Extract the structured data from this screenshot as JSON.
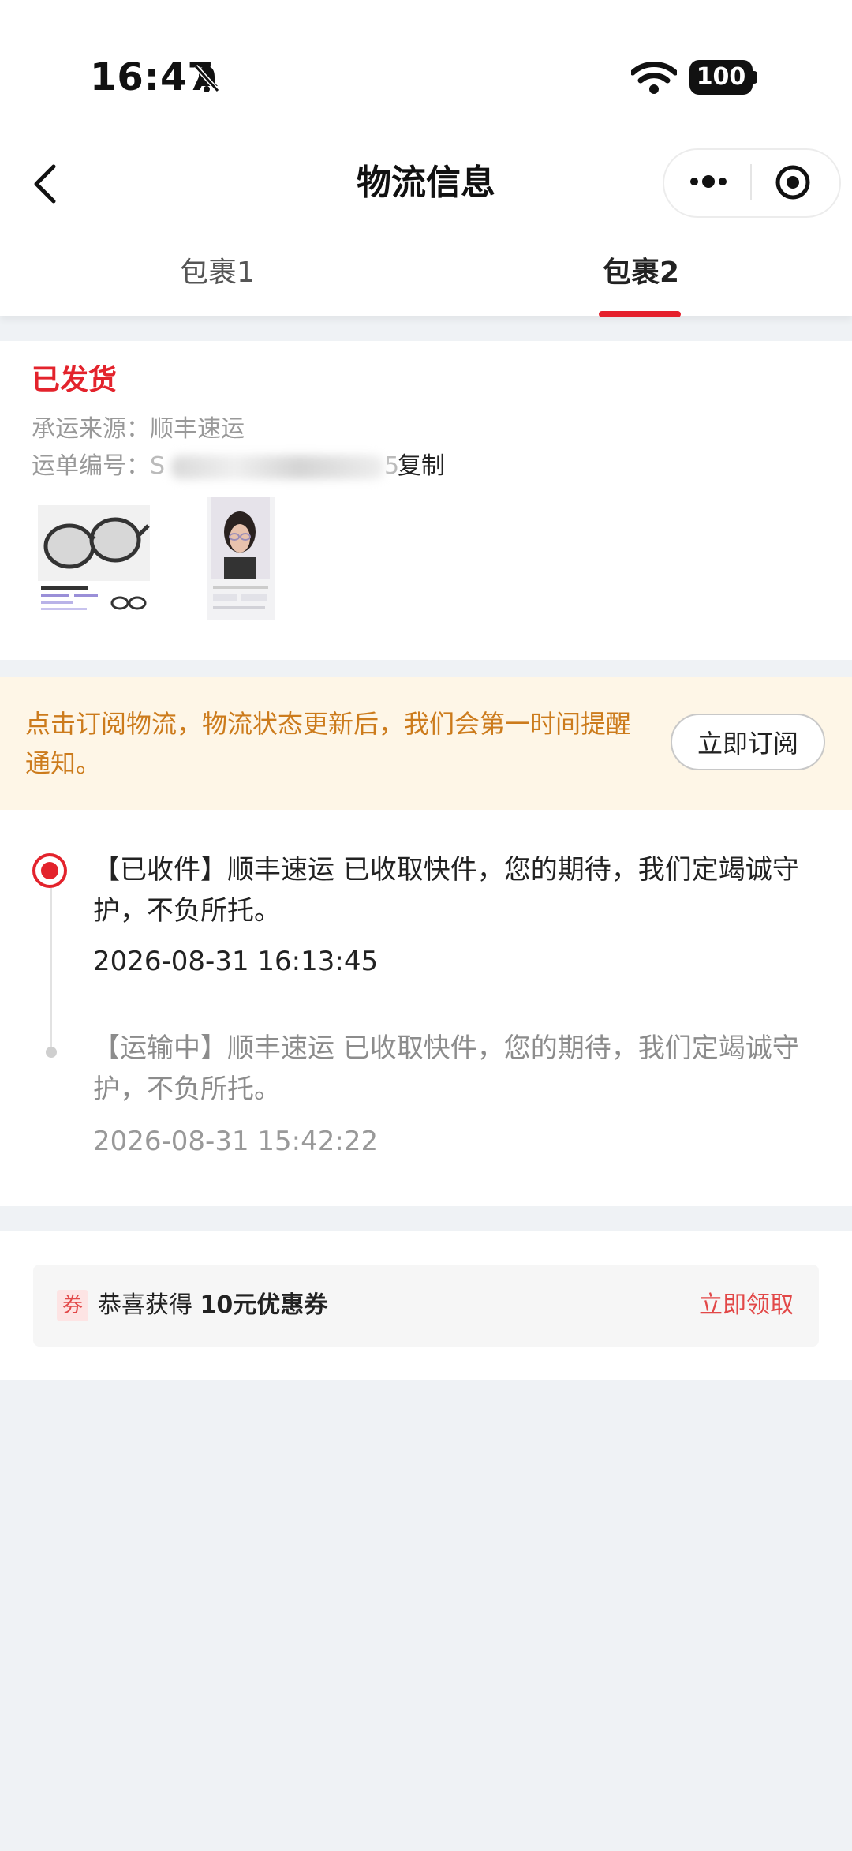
{
  "status_bar": {
    "time": "16:47",
    "battery": "100"
  },
  "nav": {
    "title": "物流信息"
  },
  "tabs": [
    {
      "label": "包裹1"
    },
    {
      "label": "包裹2"
    }
  ],
  "package": {
    "status": "已发货",
    "carrier_label": "承运来源：",
    "carrier_value": "顺丰速运",
    "waybill_label": "运单编号：",
    "waybill_visible_prefix": "S",
    "waybill_visible_suffix": "5",
    "copy_label": "复制"
  },
  "subscribe": {
    "text": "点击订阅物流，物流状态更新后，我们会第一时间提醒通知。",
    "button": "立即订阅"
  },
  "timeline": [
    {
      "text": "【已收件】顺丰速运 已收取快件，您的期待，我们定竭诚守护，不负所托。",
      "time": "2026-08-31 16:13:45"
    },
    {
      "text": "【运输中】顺丰速运 已收取快件，您的期待，我们定竭诚守护，不负所托。",
      "time": "2026-08-31 15:42:22"
    }
  ],
  "coupon": {
    "badge": "券",
    "prefix": "恭喜获得 ",
    "amount": "10元优惠券",
    "claim": "立即领取"
  },
  "colors": {
    "accent_red": "#e3232c",
    "banner_text": "#cc7b1c",
    "banner_bg": "#fef6e7"
  }
}
